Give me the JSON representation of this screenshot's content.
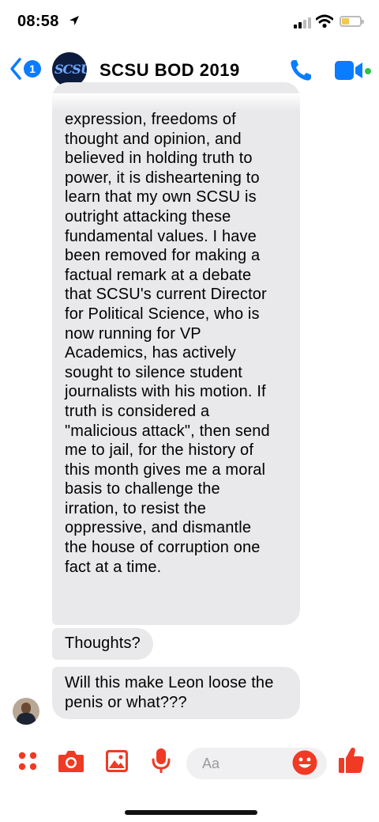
{
  "status_bar": {
    "time": "08:58"
  },
  "header": {
    "back_badge": "1",
    "group_avatar_text": "SCSU",
    "title": "SCSU BOD 2019"
  },
  "messages": {
    "long_lines": [
      "expression, freedoms of",
      "thought and opinion, and",
      "believed in holding truth to",
      "power, it is disheartening to",
      "learn that my own SCSU is",
      "outright attacking these",
      "fundamental values. I have",
      "been removed for making a",
      "factual remark at a debate",
      "that SCSU's current Director",
      "for Political Science, who is",
      "now running for VP",
      "Academics, has actively",
      "sought to silence student",
      "journalists with his motion. If",
      "truth is considered a",
      "\"malicious attack\", then send",
      "me to jail, for the history of",
      "this month gives me a moral",
      "basis to challenge the",
      "irration, to resist the",
      "oppressive, and dismantle",
      "the house of corruption one",
      "fact at a time."
    ],
    "short": "Thoughts?",
    "last_lines": [
      "Will this make Leon loose the",
      "penis or what???"
    ]
  },
  "composer": {
    "placeholder": "Aa"
  },
  "colors": {
    "messenger_blue": "#0a7cff",
    "composer_red": "#f03a24",
    "bubble_gray": "#e9e9eb",
    "online_green": "#31c04a"
  },
  "icons": [
    "location-arrow-icon",
    "signal-icon",
    "wifi-icon",
    "battery-icon",
    "back-chevron-icon",
    "phone-icon",
    "video-icon",
    "more-dots-icon",
    "camera-icon",
    "gallery-icon",
    "microphone-icon",
    "emoji-icon",
    "thumbs-up-icon"
  ]
}
